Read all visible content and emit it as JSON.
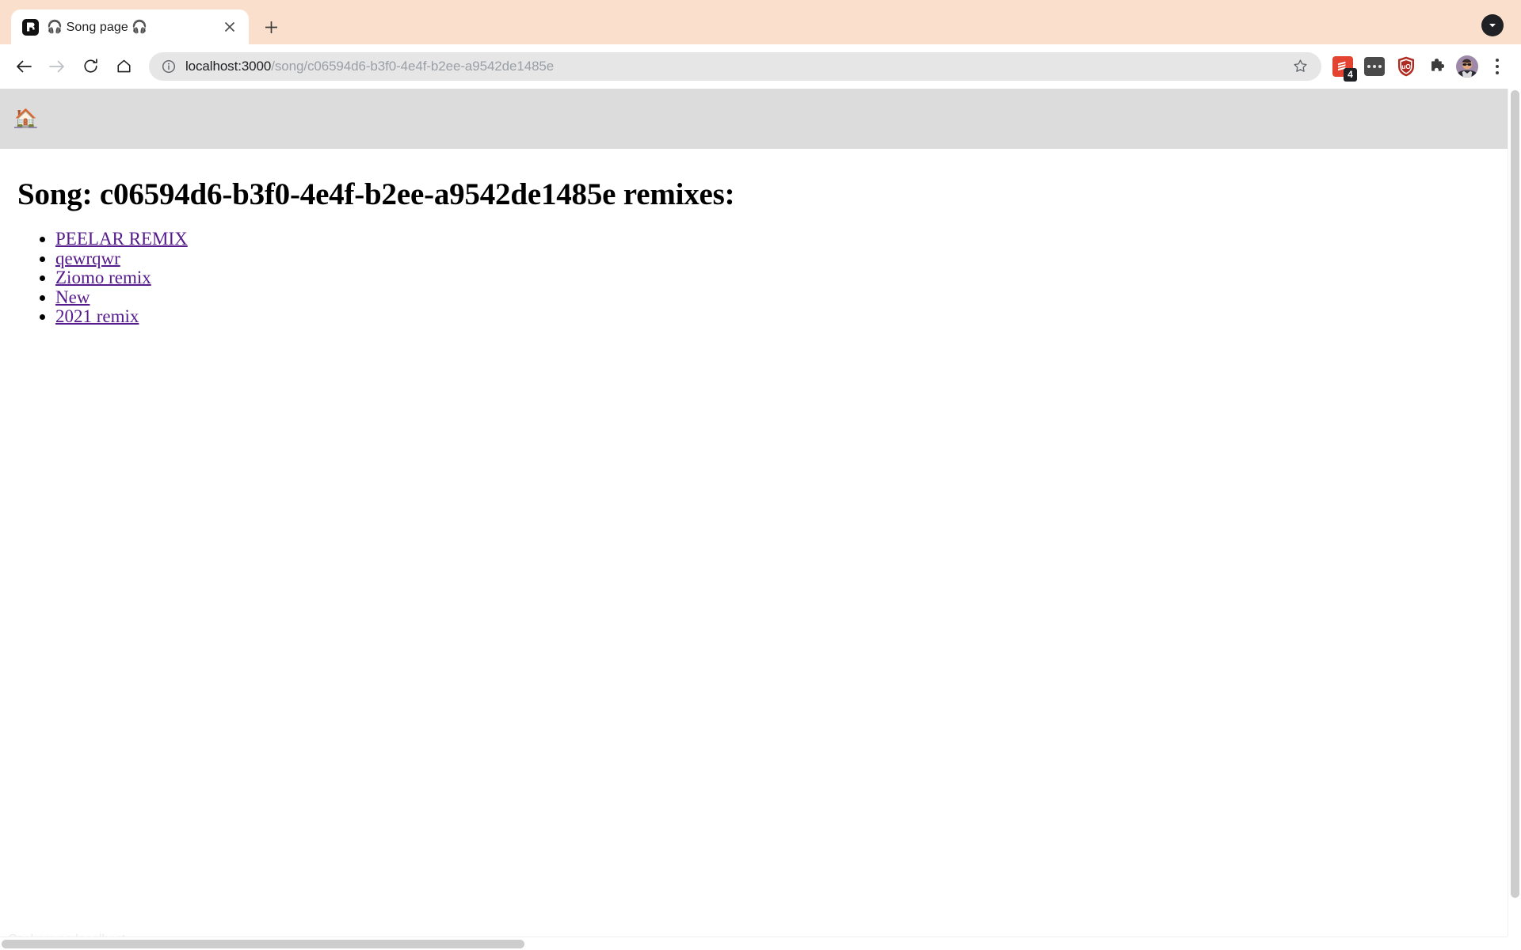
{
  "browser": {
    "tab": {
      "title": "🎧 Song page 🎧",
      "favicon_name": "remix-logo-favicon",
      "close_label": "✕"
    },
    "newtab_label": "+",
    "tabsearch_name": "tab-search-chevron-down",
    "nav": {
      "back_label": "←",
      "forward_label": "→",
      "reload_label": "⟳",
      "home_label": "⌂"
    },
    "omnibox": {
      "host": "localhost:3000",
      "path": "/song/c06594d6-b3f0-4e4f-b2ee-a9542de1485e",
      "full_url": "localhost:3000/song/c06594d6-b3f0-4e4f-b2ee-a9542de1485e",
      "info_icon": "site-information-icon",
      "bookmark_icon": "bookmark-star-icon"
    },
    "extensions": [
      {
        "name": "todoist-extension",
        "badge": "4",
        "color": "#e44332"
      },
      {
        "name": "dots-extension",
        "color": "#4a4a4a"
      },
      {
        "name": "ublock-origin-extension",
        "label": "uO",
        "color": "#b02b20"
      },
      {
        "name": "extensions-puzzle-icon",
        "color": "#3c3c3c"
      }
    ],
    "avatar_name": "profile-avatar",
    "menu_name": "chrome-menu-icon",
    "chrome_accent": "#fbdfcd"
  },
  "page": {
    "header": {
      "home_link": "🏠"
    },
    "title": "Song: c06594d6-b3f0-4e4f-b2ee-a9542de1485e remixes:",
    "remixes": [
      {
        "label": "PEELAR REMIX"
      },
      {
        "label": "qewrqwr"
      },
      {
        "label": "Ziomo remix"
      },
      {
        "label": "New"
      },
      {
        "label": "2021 remix"
      }
    ],
    "status_text": "Czekam na localhost...",
    "link_color": "#551a8b",
    "header_bg": "#dcdcdc"
  }
}
